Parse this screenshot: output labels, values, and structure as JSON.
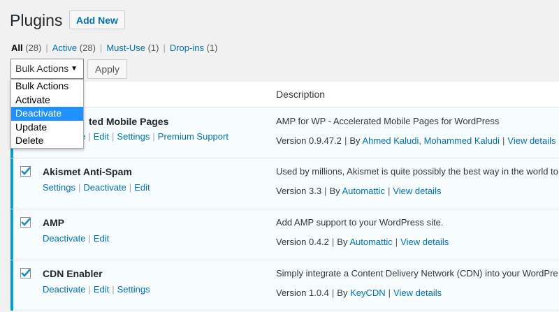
{
  "header": {
    "title": "Plugins",
    "add_new_label": "Add New"
  },
  "filters": [
    {
      "label": "All",
      "count": "(28)",
      "current": true
    },
    {
      "label": "Active",
      "count": "(28)",
      "current": false
    },
    {
      "label": "Must-Use",
      "count": "(1)",
      "current": false
    },
    {
      "label": "Drop-ins",
      "count": "(1)",
      "current": false
    }
  ],
  "bulk": {
    "selected": "Bulk Actions",
    "apply_label": "Apply",
    "options": [
      "Bulk Actions",
      "Activate",
      "Deactivate",
      "Update",
      "Delete"
    ],
    "highlighted": "Deactivate"
  },
  "table": {
    "col_description": "Description",
    "plugins": [
      {
        "name_visible": "ted Mobile Pages",
        "actions_visible": [
          "e",
          "Edit",
          "Settings",
          "Premium Support"
        ],
        "description": "AMP for WP - Accelerated Mobile Pages for WordPress",
        "version": "Version 0.9.47.2",
        "by": "By",
        "author": "Ahmed Kaludi, Mohammed Kaludi",
        "details": "View details"
      },
      {
        "name": "Akismet Anti-Spam",
        "actions": [
          "Settings",
          "Deactivate",
          "Edit"
        ],
        "description": "Used by millions, Akismet is quite possibly the best way in the world to",
        "version": "Version 3.3",
        "by": "By",
        "author": "Automattic",
        "details": "View details"
      },
      {
        "name": "AMP",
        "actions": [
          "Deactivate",
          "Edit"
        ],
        "description": "Add AMP support to your WordPress site.",
        "version": "Version 0.4.2",
        "by": "By",
        "author": "Automattic",
        "details": "View details"
      },
      {
        "name": "CDN Enabler",
        "actions": [
          "Deactivate",
          "Edit",
          "Settings"
        ],
        "description": "Simply integrate a Content Delivery Network (CDN) into your WordPre",
        "version": "Version 1.0.4",
        "by": "By",
        "author": "KeyCDN",
        "details": "View details"
      }
    ]
  },
  "colors": {
    "link": "#0073aa",
    "active_bar": "#00a0d2",
    "highlight": "#1e90ff"
  },
  "icons": {
    "checkbox_check": "check-icon",
    "select_arrow": "triangle-down-icon"
  }
}
